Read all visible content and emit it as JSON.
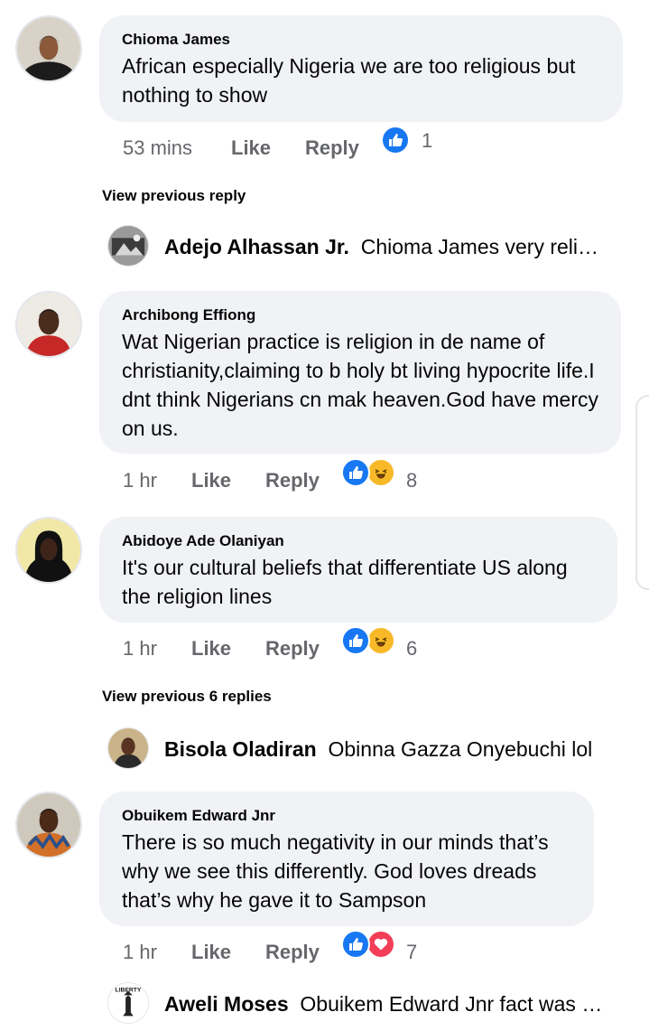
{
  "comments": [
    {
      "author": "Chioma James",
      "text": "African especially Nigeria we are too religious but nothing to show",
      "time": "53 mins",
      "like_label": "Like",
      "reply_label": "Reply",
      "reaction_icons": [
        "like-icon"
      ],
      "reaction_count": "1"
    },
    {
      "author": "Archibong Effiong",
      "text": "Wat Nigerian practice is religion in de name of christianity,claiming to b holy bt living hypocrite life.I dnt think Nigerians cn mak heaven.God have mercy on us.",
      "time": "1 hr",
      "like_label": "Like",
      "reply_label": "Reply",
      "reaction_icons": [
        "like-icon",
        "haha-icon"
      ],
      "reaction_count": "8"
    },
    {
      "author": "Abidoye Ade Olaniyan",
      "text": "It's our cultural beliefs that differentiate US along the religion lines",
      "time": "1 hr",
      "like_label": "Like",
      "reply_label": "Reply",
      "reaction_icons": [
        "like-icon",
        "haha-icon"
      ],
      "reaction_count": "6"
    },
    {
      "author": "Obuikem Edward Jnr",
      "text": "There is so much negativity in our minds that’s why we see this differently. God loves dreads that’s why he gave it to Sampson",
      "time": "1 hr",
      "like_label": "Like",
      "reply_label": "Reply",
      "reaction_icons": [
        "like-icon",
        "love-icon"
      ],
      "reaction_count": "7"
    }
  ],
  "view_previous": [
    {
      "label": "View previous reply"
    },
    {
      "label": "View previous 6 replies"
    }
  ],
  "replies": [
    {
      "author": "Adejo Alhassan Jr.",
      "preview": "Chioma James very religious"
    },
    {
      "author": "Bisola Oladiran",
      "preview": "Obinna Gazza Onyebuchi  lol"
    },
    {
      "author": "Aweli Moses",
      "preview": "Obuikem Edward Jnr fact was said"
    }
  ],
  "logo_text": "LIBERTY",
  "colors": {
    "bubble": "#f0f2f5",
    "meta_text": "#65676b",
    "like_blue": "#1877f2",
    "haha_yellow": "#f7b928",
    "love_red": "#f33e58"
  }
}
